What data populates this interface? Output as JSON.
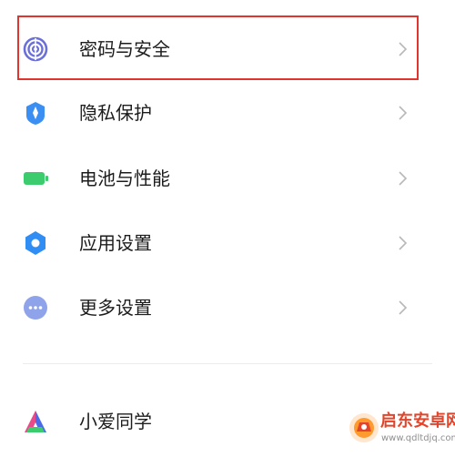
{
  "settings": {
    "items": [
      {
        "label": "密码与安全",
        "icon": "fingerprint-icon",
        "color": "#6b6fd8"
      },
      {
        "label": "隐私保护",
        "icon": "shield-icon",
        "color": "#3b8ff3"
      },
      {
        "label": "电池与性能",
        "icon": "battery-icon",
        "color": "#3ccb6d"
      },
      {
        "label": "应用设置",
        "icon": "gear-icon",
        "color": "#2f8df4"
      },
      {
        "label": "更多设置",
        "icon": "more-icon",
        "color": "#8ea3ea"
      },
      {
        "label": "小爱同学",
        "icon": "xiaoai-icon",
        "color": "#4a6ae8"
      }
    ]
  },
  "highlight": {
    "color": "#e0342f"
  },
  "watermark": {
    "title": "启东安卓网",
    "url": "www.qdltdjq.com",
    "color": "#e2452b"
  }
}
